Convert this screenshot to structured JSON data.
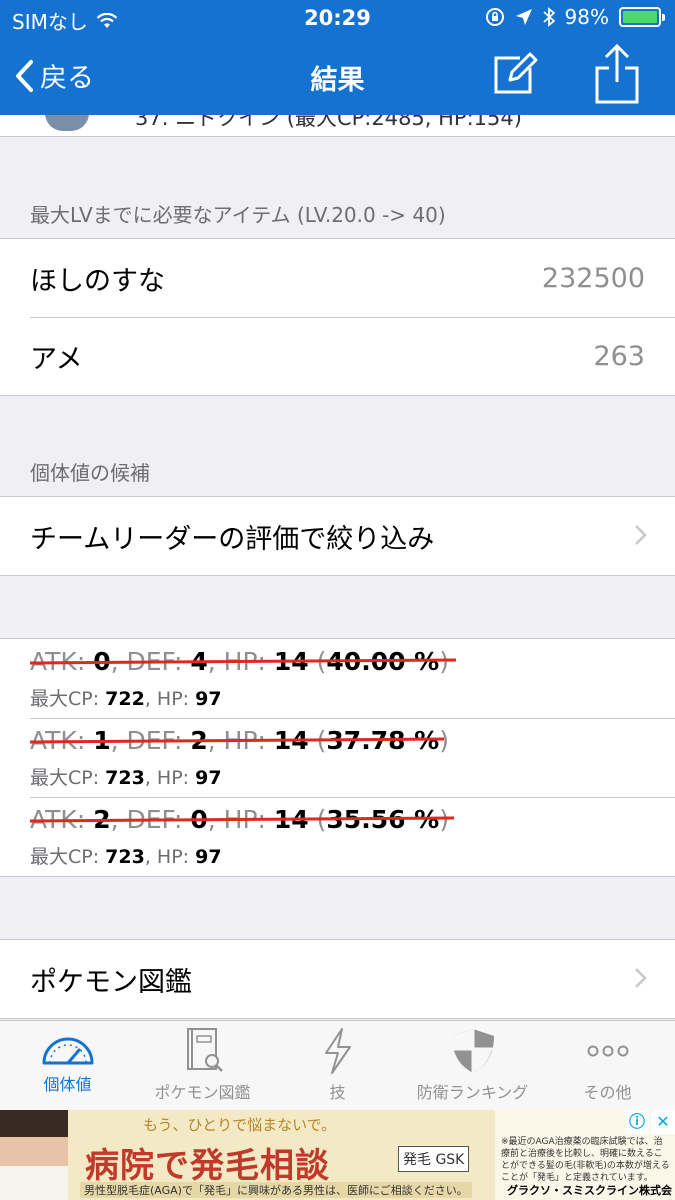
{
  "status": {
    "carrier": "SIMなし",
    "time": "20:29",
    "battery": "98%"
  },
  "nav": {
    "back_label": "戻る",
    "title": "結果"
  },
  "top_row_text": "37. ニドクイン (最大CP:2485, HP:154)",
  "items_section": {
    "header": "最大LVまでに必要なアイテム (LV.20.0 -> 40)",
    "rows": [
      {
        "label": "ほしのすな",
        "value": "232500"
      },
      {
        "label": "アメ",
        "value": "263"
      }
    ]
  },
  "iv_section": {
    "header": "個体値の候補",
    "filter_label": "チームリーダーの評価で絞り込み"
  },
  "iv_candidates": [
    {
      "atk": "0",
      "def": "4",
      "hp": "14",
      "percent": "40.00 %",
      "cp": "722",
      "maxhp": "97"
    },
    {
      "atk": "1",
      "def": "2",
      "hp": "14",
      "percent": "37.78 %",
      "cp": "723",
      "maxhp": "97"
    },
    {
      "atk": "2",
      "def": "0",
      "hp": "14",
      "percent": "35.56 %",
      "cp": "723",
      "maxhp": "97"
    }
  ],
  "labels": {
    "atk": "ATK: ",
    "def": ", DEF: ",
    "hp": ", HP: ",
    "maxcp": "最大CP: ",
    "sub_hp": ", HP: "
  },
  "dex_row": {
    "label": "ポケモン図鑑"
  },
  "tabs": [
    {
      "label": "個体値",
      "icon": "gauge-icon",
      "active": true
    },
    {
      "label": "ポケモン図鑑",
      "icon": "book-search-icon",
      "active": false
    },
    {
      "label": "技",
      "icon": "lightning-icon",
      "active": false
    },
    {
      "label": "防衛ランキング",
      "icon": "shield-icon",
      "active": false
    },
    {
      "label": "その他",
      "icon": "more-icon",
      "active": false
    }
  ],
  "ad": {
    "tagline": "もう、ひとりで悩まないで。",
    "headline": "病院で発毛相談",
    "badge": "発毛 GSK",
    "footnote": "男性型脱毛症(AGA)で「発毛」に興味がある男性は、医師にご相談ください。",
    "fine_print": "※最近のAGA治療薬の臨床試験では、治療前と治療後を比較し、明確に数えることができる髪の毛(非軟毛)の本数が増えることが「発毛」と定義されています。",
    "company": "グラクソ・スミスクライン株式会社"
  },
  "colors": {
    "accent": "#1572d1",
    "strike": "#e0281e",
    "battery": "#4cd964"
  }
}
